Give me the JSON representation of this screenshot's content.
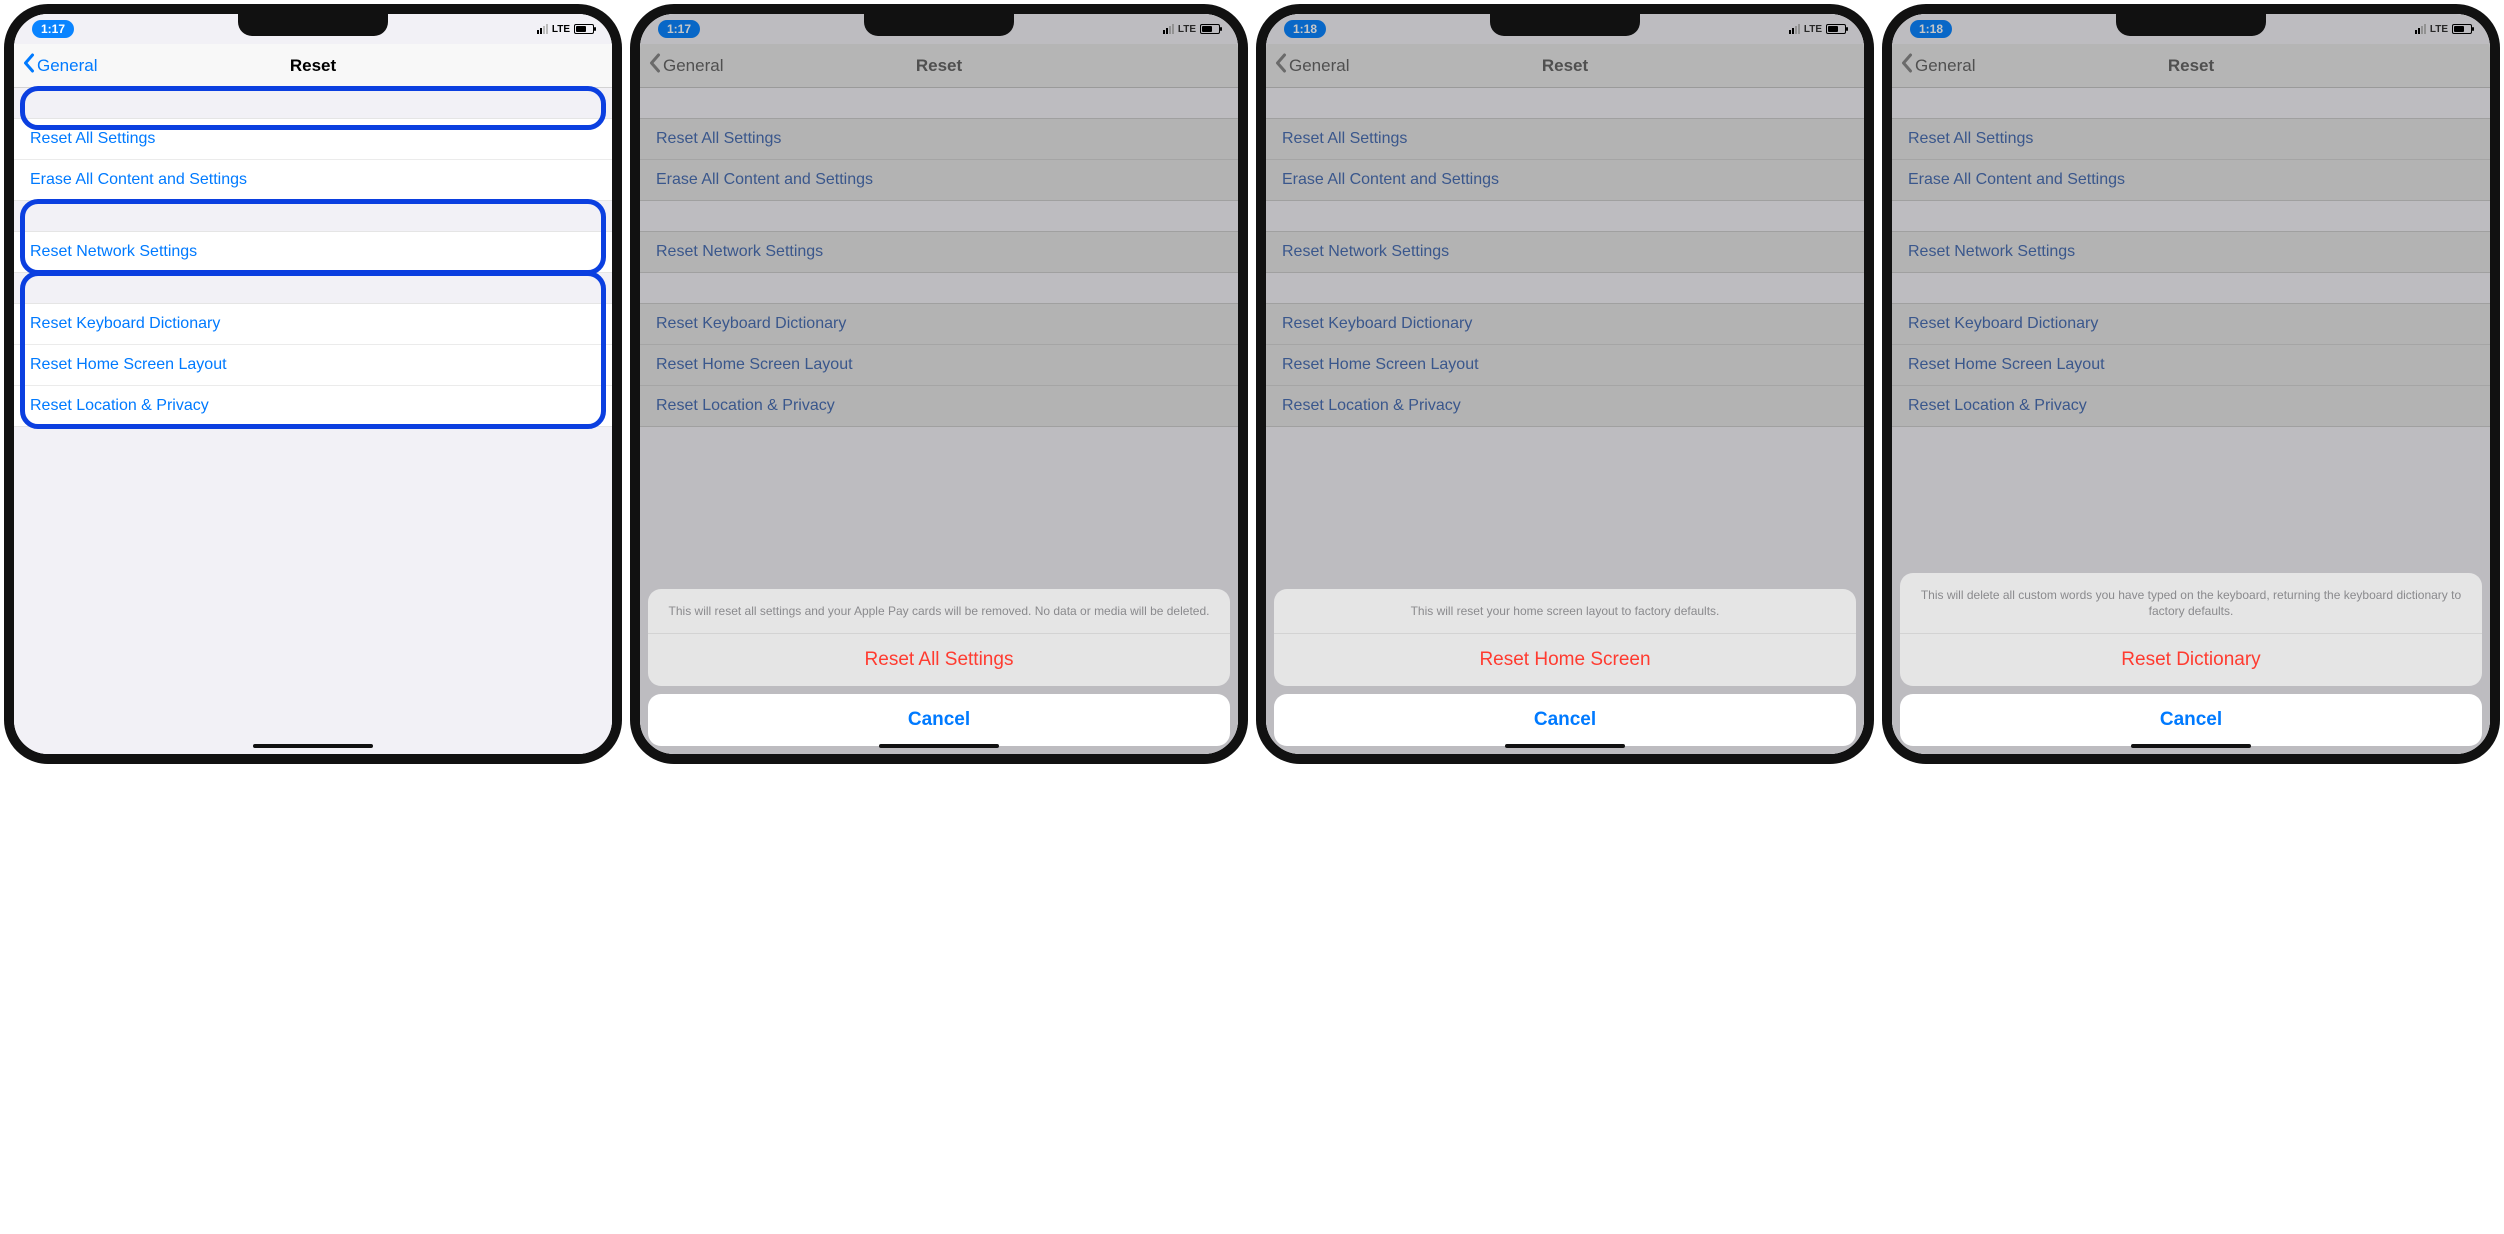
{
  "phones": [
    {
      "time": "1:17",
      "carrier": "LTE",
      "nav_back": "General",
      "nav_title": "Reset",
      "groups": [
        {
          "highlight": "first",
          "rows": [
            "Reset All Settings",
            "Erase All Content and Settings"
          ]
        },
        {
          "highlight": "all",
          "rows": [
            "Reset Network Settings"
          ]
        },
        {
          "highlight": "all",
          "rows": [
            "Reset Keyboard Dictionary",
            "Reset Home Screen Layout",
            "Reset Location & Privacy"
          ]
        }
      ],
      "sheet": null
    },
    {
      "time": "1:17",
      "carrier": "LTE",
      "nav_back": "General",
      "nav_title": "Reset",
      "groups": [
        {
          "rows": [
            "Reset All Settings",
            "Erase All Content and Settings"
          ]
        },
        {
          "rows": [
            "Reset Network Settings"
          ]
        },
        {
          "rows": [
            "Reset Keyboard Dictionary",
            "Reset Home Screen Layout",
            "Reset Location & Privacy"
          ]
        }
      ],
      "sheet": {
        "message": "This will reset all settings and your Apple Pay cards will be removed. No data or media will be deleted.",
        "action": "Reset All Settings",
        "cancel": "Cancel"
      }
    },
    {
      "time": "1:18",
      "carrier": "LTE",
      "nav_back": "General",
      "nav_title": "Reset",
      "groups": [
        {
          "rows": [
            "Reset All Settings",
            "Erase All Content and Settings"
          ]
        },
        {
          "rows": [
            "Reset Network Settings"
          ]
        },
        {
          "rows": [
            "Reset Keyboard Dictionary",
            "Reset Home Screen Layout",
            "Reset Location & Privacy"
          ]
        }
      ],
      "sheet": {
        "message": "This will reset your home screen layout to factory defaults.",
        "action": "Reset Home Screen",
        "cancel": "Cancel"
      }
    },
    {
      "time": "1:18",
      "carrier": "LTE",
      "nav_back": "General",
      "nav_title": "Reset",
      "groups": [
        {
          "rows": [
            "Reset All Settings",
            "Erase All Content and Settings"
          ]
        },
        {
          "rows": [
            "Reset Network Settings"
          ]
        },
        {
          "rows": [
            "Reset Keyboard Dictionary",
            "Reset Home Screen Layout",
            "Reset Location & Privacy"
          ]
        }
      ],
      "sheet": {
        "message": "This will delete all custom words you have typed on the keyboard, returning the keyboard dictionary to factory defaults.",
        "action": "Reset Dictionary",
        "cancel": "Cancel"
      }
    }
  ]
}
